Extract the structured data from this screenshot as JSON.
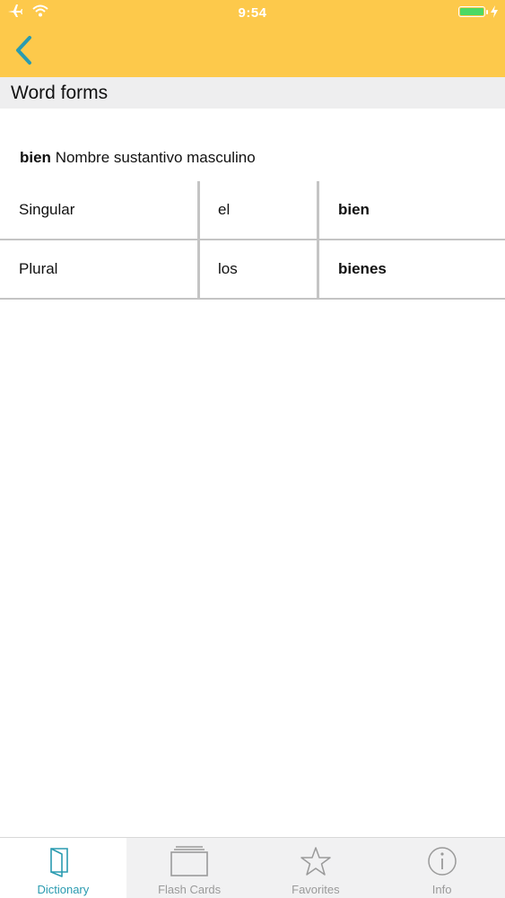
{
  "status_bar": {
    "time": "9:54",
    "icons": [
      "airplane-icon",
      "wifi-icon",
      "battery-icon",
      "charging-icon"
    ]
  },
  "nav": {
    "back_icon": "chevron-left-icon",
    "accent_color": "#2a9bb0",
    "bar_color": "#fdc94b"
  },
  "section": {
    "title": "Word forms"
  },
  "entry": {
    "word": "bien",
    "description": "Nombre sustantivo masculino"
  },
  "forms": [
    {
      "number": "Singular",
      "article": "el",
      "form": "bien"
    },
    {
      "number": "Plural",
      "article": "los",
      "form": "bienes"
    }
  ],
  "tabs": [
    {
      "label": "Dictionary",
      "icon": "book-icon",
      "active": true
    },
    {
      "label": "Flash Cards",
      "icon": "flash-cards-icon",
      "active": false
    },
    {
      "label": "Favorites",
      "icon": "star-icon",
      "active": false
    },
    {
      "label": "Info",
      "icon": "info-icon",
      "active": false
    }
  ]
}
